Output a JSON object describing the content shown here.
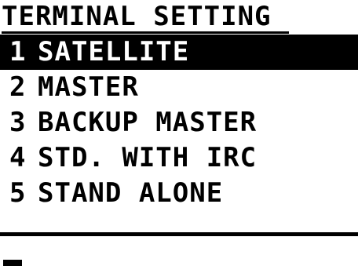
{
  "screen": {
    "title": "TERMINAL SETTING"
  },
  "menu": {
    "items": [
      {
        "number": "1",
        "label": "SATELLITE",
        "selected": true
      },
      {
        "number": "2",
        "label": "MASTER",
        "selected": false
      },
      {
        "number": "3",
        "label": "BACKUP MASTER",
        "selected": false
      },
      {
        "number": "4",
        "label": "STD. WITH IRC",
        "selected": false
      },
      {
        "number": "5",
        "label": "STAND ALONE",
        "selected": false
      }
    ]
  },
  "input": {
    "value": ""
  },
  "colors": {
    "background": "#ffffff",
    "foreground": "#000000",
    "highlight": "#000000",
    "highlight_text": "#ffffff"
  }
}
